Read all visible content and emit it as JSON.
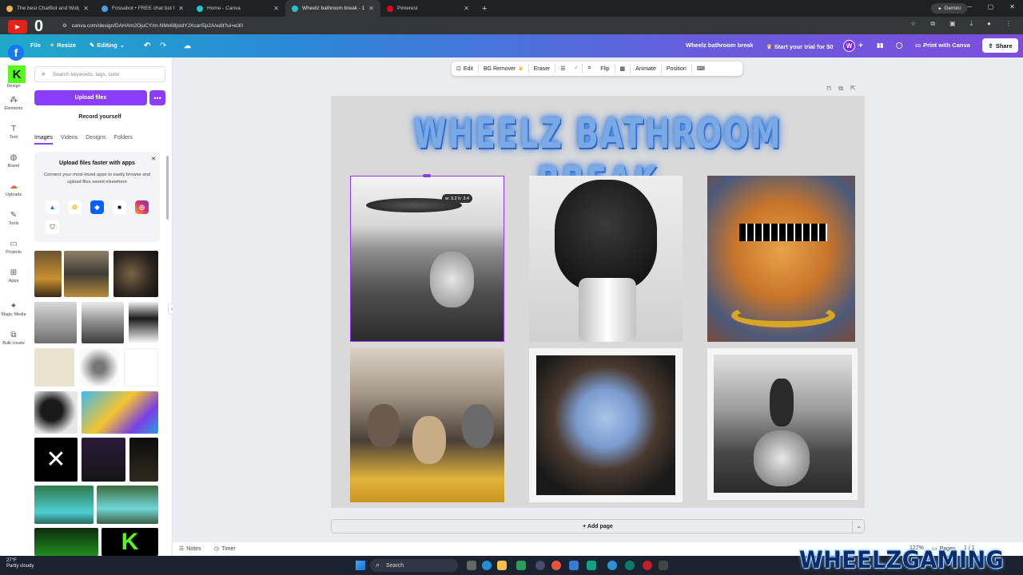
{
  "browser": {
    "tabs": [
      {
        "title": "The best ChatBot and Widgets",
        "color": "#e8b84a"
      },
      {
        "title": "Fossabot • FREE chat bot for Tw",
        "color": "#4a9be8"
      },
      {
        "title": "Home - Canva",
        "color": "#20c4cb"
      },
      {
        "title": "Wheelz bathroom break - 11 x",
        "color": "#20c4cb"
      },
      {
        "title": "Pinterest",
        "color": "#e60023"
      }
    ],
    "gemini": "Gemini",
    "url": "canva.com/design/DAHAm2OjuCY/m-NMx68jsIdYJXcarI5p2A/edit?ui=e30",
    "counter": "0"
  },
  "canva_top": {
    "file": "File",
    "resize": "Resize",
    "editing": "Editing",
    "design_title": "Wheelz bathroom break",
    "trial": "Start your trial for $0",
    "avatar": "W",
    "print": "Print with Canva",
    "share": "Share"
  },
  "rail": [
    {
      "icon": "▦",
      "label": "Design"
    },
    {
      "icon": "⁂",
      "label": "Elements"
    },
    {
      "icon": "T",
      "label": "Text"
    },
    {
      "icon": "◍",
      "label": "Brand"
    },
    {
      "icon": "☁",
      "label": "Uploads"
    },
    {
      "icon": "✎",
      "label": "Tools"
    },
    {
      "icon": "▭",
      "label": "Projects"
    },
    {
      "icon": "⊞",
      "label": "Apps"
    },
    {
      "icon": "✦",
      "label": "Magic Media"
    },
    {
      "icon": "⧉",
      "label": "Bulk create"
    }
  ],
  "panel": {
    "search_placeholder": "Search keywords, tags, color",
    "upload": "Upload files",
    "more": "•••",
    "record": "Record yourself",
    "tabs": [
      "Images",
      "Videos",
      "Designs",
      "Folders"
    ],
    "apps_title": "Upload files faster with apps",
    "apps_desc": "Connect your most-loved apps to easily browse and upload files saved elsewhere"
  },
  "toolbar": [
    "Edit",
    "BG Remover",
    "Eraser",
    "Flip",
    "Animate",
    "Position"
  ],
  "canvas": {
    "title": "WHEELZ BATHROOM BREAK",
    "dim_tag": "w: 3.2 h: 3.4"
  },
  "add_page": "+ Add page",
  "footer": {
    "notes": "Notes",
    "timer": "Timer",
    "zoom": "127%",
    "pages": "Pages",
    "page_count": "1 / 1"
  },
  "taskbar": {
    "temp": "27°F",
    "condition": "Partly cloudy",
    "search": "Search"
  },
  "watermark": "WHEELZGAMING",
  "colors": {
    "accent": "#8b3dff",
    "title": "#7aa9e6"
  }
}
